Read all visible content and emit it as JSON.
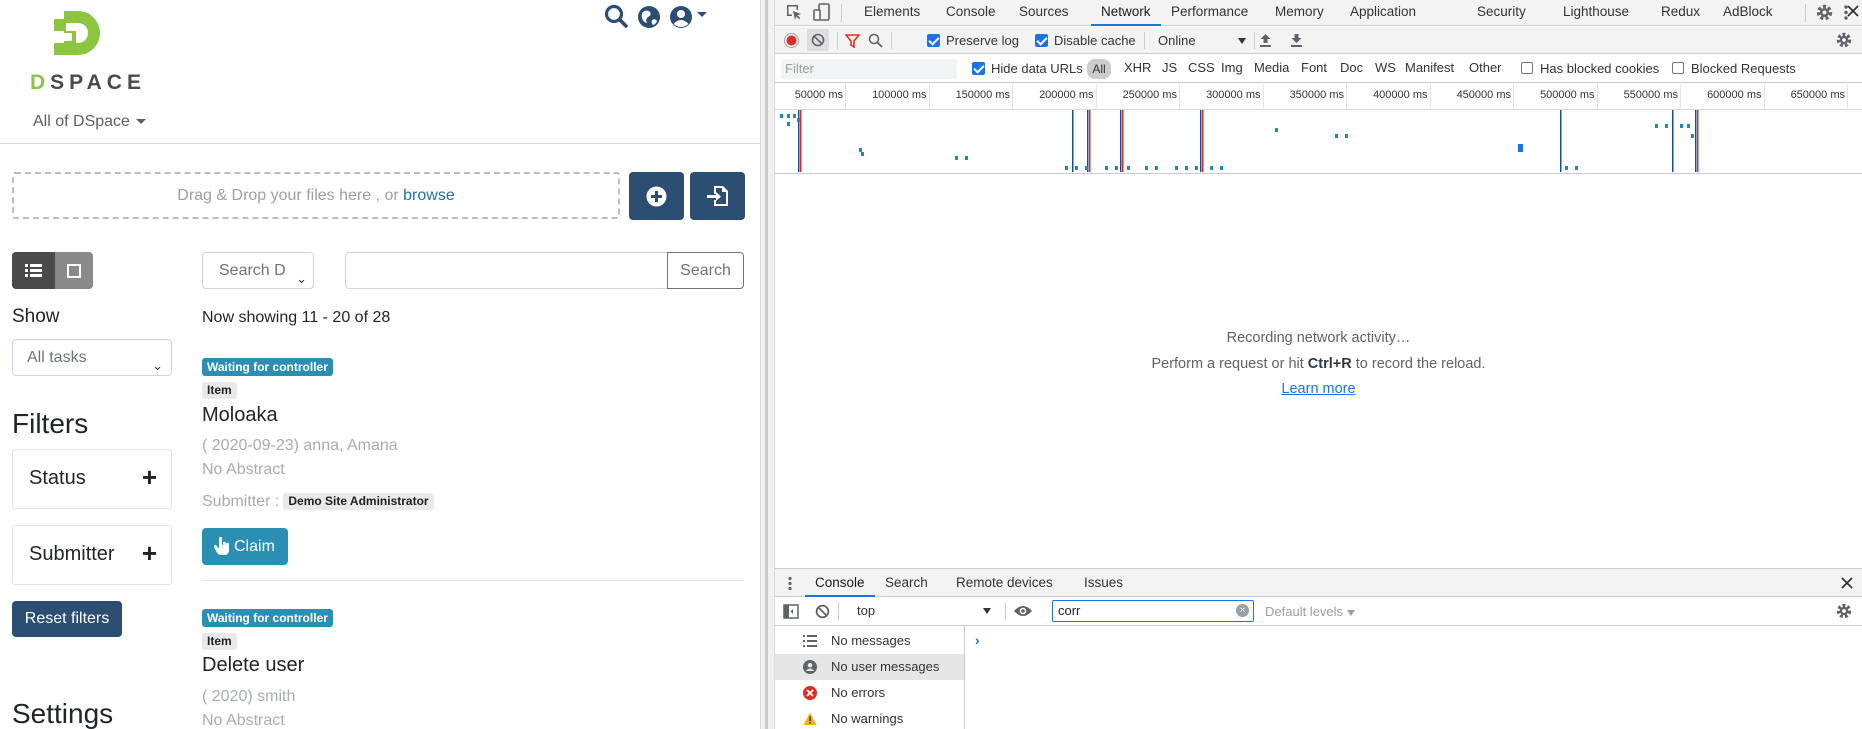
{
  "header": {
    "logo_text_d": "D",
    "logo_text_rest": "SPACE",
    "scope_label": "All of DSpace",
    "icons": [
      "search-icon",
      "globe-icon",
      "user-icon",
      "chevron-down-icon"
    ]
  },
  "upload": {
    "drop_text": "Drag & Drop your files here , or ",
    "browse_text": "browse"
  },
  "sidebar": {
    "show_label": "Show",
    "task_select_value": "All tasks",
    "filters_title": "Filters",
    "facets": [
      {
        "label": "Status"
      },
      {
        "label": "Submitter"
      }
    ],
    "reset_label": "Reset filters",
    "settings_title": "Settings"
  },
  "search": {
    "scope_value": "Search D",
    "query_value": "",
    "button_label": "Search"
  },
  "results": {
    "showing_text": "Now showing 11 - 20 of 28",
    "items": [
      {
        "status": "Waiting for controller",
        "type": "Item",
        "title": "Moloaka",
        "meta": "( 2020-09-23) anna, Amana",
        "abstract": "No Abstract",
        "submitter_label": "Submitter :",
        "submitter": "Demo Site Administrator",
        "claim_label": "Claim"
      },
      {
        "status": "Waiting for controller",
        "type": "Item",
        "title": "Delete user",
        "meta": "( 2020) smith",
        "abstract": "No Abstract"
      }
    ]
  },
  "devtools": {
    "tabs": [
      "Elements",
      "Console",
      "Sources",
      "Network",
      "Performance",
      "Memory",
      "Application",
      "Security",
      "Lighthouse",
      "Redux",
      "AdBlock"
    ],
    "active_tab": "Network",
    "toolbar": {
      "preserve_log": "Preserve log",
      "preserve_log_checked": true,
      "disable_cache": "Disable cache",
      "disable_cache_checked": true,
      "throttling": "Online"
    },
    "filter": {
      "placeholder": "Filter",
      "hide_data_urls": "Hide data URLs",
      "hide_data_urls_checked": true,
      "types": [
        "All",
        "XHR",
        "JS",
        "CSS",
        "Img",
        "Media",
        "Font",
        "Doc",
        "WS",
        "Manifest",
        "Other"
      ],
      "has_blocked_cookies": "Has blocked cookies",
      "blocked_requests": "Blocked Requests"
    },
    "timeline_ticks": [
      "50000 ms",
      "100000 ms",
      "150000 ms",
      "200000 ms",
      "250000 ms",
      "300000 ms",
      "350000 ms",
      "400000 ms",
      "450000 ms",
      "500000 ms",
      "550000 ms",
      "600000 ms",
      "650000 ms"
    ],
    "empty_state": {
      "line1": "Recording network activity…",
      "line2_pre": "Perform a request or hit ",
      "line2_key": "Ctrl+R",
      "line2_post": " to record the reload.",
      "learn_more": "Learn more"
    },
    "drawer": {
      "tabs": [
        "Console",
        "Search",
        "Remote devices",
        "Issues"
      ],
      "active_tab": "Console",
      "context": "top",
      "filter_value": "corr",
      "levels": "Default levels",
      "sidebar_items": [
        "No messages",
        "No user messages",
        "No errors",
        "No warnings"
      ],
      "selected_sidebar_item": "No user messages"
    },
    "colors": {
      "accent": "#1a73e8",
      "record": "#d93025"
    }
  }
}
